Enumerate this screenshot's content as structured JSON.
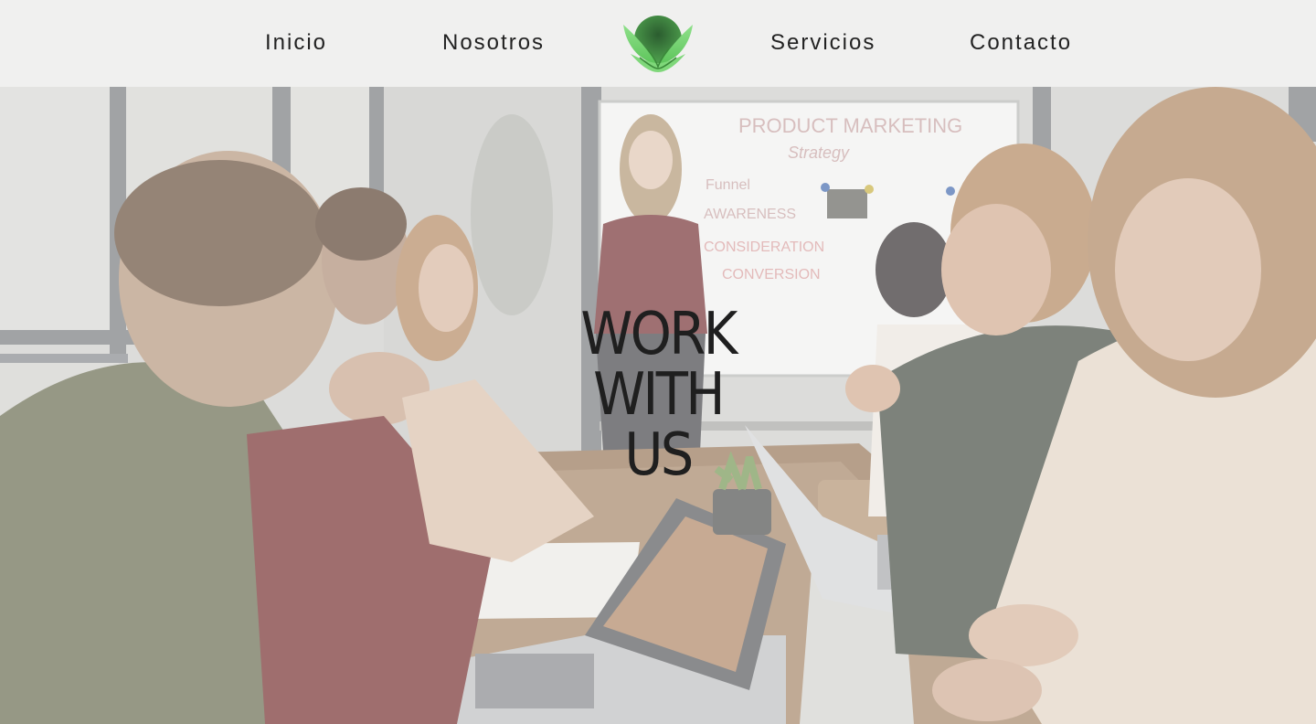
{
  "nav": {
    "items": [
      {
        "label": "Inicio"
      },
      {
        "label": "Nosotros"
      },
      {
        "label": "Servicios"
      },
      {
        "label": "Contacto"
      }
    ],
    "logo_icon": "leaf-logo-icon"
  },
  "hero": {
    "title_lines": [
      "WORK",
      "WITH",
      "US"
    ],
    "whiteboard": {
      "heading": "PRODUCT MARKETING",
      "subheading": "Strategy",
      "lines": [
        "Funnel",
        "AWARENESS",
        "CONSIDERATION",
        "CONVERSION"
      ]
    }
  },
  "colors": {
    "nav_background": "#f0f0ef",
    "text": "#222222",
    "logo_green": "#6fcf6a",
    "logo_dark": "#2f6b34"
  }
}
